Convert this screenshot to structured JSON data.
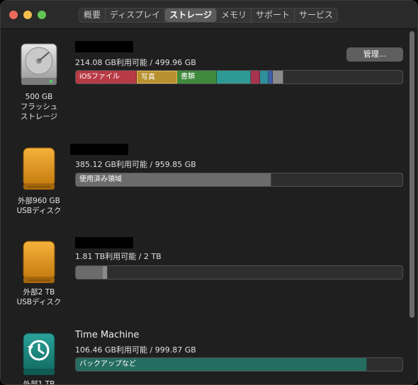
{
  "tabs": [
    {
      "label": "概要"
    },
    {
      "label": "ディスプレイ"
    },
    {
      "label": "ストレージ"
    },
    {
      "label": "メモリ"
    },
    {
      "label": "サポート"
    },
    {
      "label": "サービス"
    }
  ],
  "drives": [
    {
      "caption": [
        "500 GB",
        "フラッシュ",
        "ストレージ"
      ],
      "available": "214.08 GB利用可能 / 499.96 GB",
      "manage_label": "管理...",
      "segments": [
        {
          "label": "iOSファイル",
          "color": "#b73b46"
        },
        {
          "label": "写真",
          "color": "#b8902e"
        },
        {
          "label": "書類",
          "color": "#3f8a3c"
        },
        {
          "label": "",
          "color": "#2f9a95"
        },
        {
          "label": "",
          "color": "#a83350"
        },
        {
          "label": "",
          "color": "#2f8f9a"
        },
        {
          "label": "",
          "color": "#3d5ea8"
        },
        {
          "label": "",
          "color": "#8a8a8a"
        }
      ]
    },
    {
      "caption": [
        "外部960 GB",
        "USBディスク"
      ],
      "available": "385.12 GB利用可能 / 959.85 GB",
      "segments": [
        {
          "label": "使用済み領域",
          "color": "#6b6b6b"
        }
      ]
    },
    {
      "caption": [
        "外部2 TB",
        "USBディスク"
      ],
      "available": "1.81 TB利用可能 / 2 TB",
      "segments": [
        {
          "label": "",
          "color": "#6b6b6b"
        }
      ]
    },
    {
      "name": "Time Machine",
      "caption": [
        "外部1 TB"
      ],
      "available": "106.46 GB利用可能 / 999.87 GB",
      "segments": [
        {
          "label": "バックアップなど",
          "color": "#256d61"
        }
      ]
    }
  ]
}
